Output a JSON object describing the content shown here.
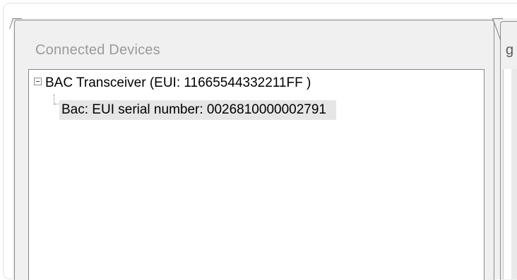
{
  "panel": {
    "title": "Connected Devices"
  },
  "tree": {
    "root": {
      "label": "BAC Transceiver (EUI: 11665544332211FF )",
      "expanded": true
    },
    "child": {
      "label": "Bac: EUI serial number: 0026810000002791",
      "selected": true
    }
  },
  "right_panel": {
    "title_fragment": "g"
  }
}
